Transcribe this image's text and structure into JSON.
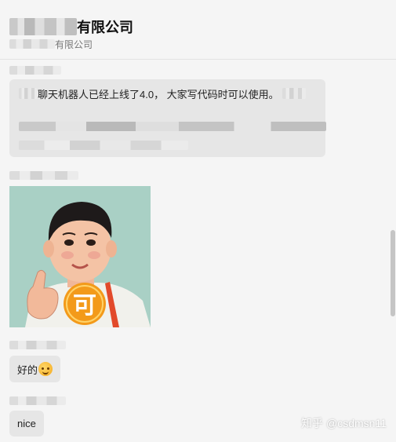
{
  "header": {
    "title": "有限公司",
    "subtitle": "有限公司"
  },
  "messages": [
    {
      "type": "text",
      "visible_text": "聊天机器人已经上线了4.0， 大家写代码时可以使用。"
    },
    {
      "type": "sticker",
      "sticker_char": "可"
    },
    {
      "type": "text",
      "text": "好的",
      "emoji": "smiling-face-emoji"
    },
    {
      "type": "text",
      "text": "nice"
    }
  ],
  "watermark": {
    "site": "知乎",
    "handle": "@csdmsn11"
  },
  "colors": {
    "background": "#f5f5f5",
    "bubble": "#e6e6e6",
    "sticker_accent": "#f39a1a"
  }
}
